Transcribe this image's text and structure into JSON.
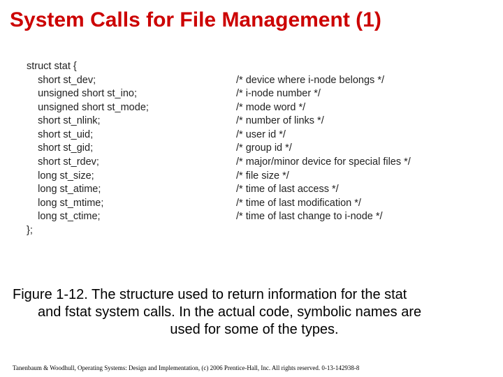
{
  "title": "System Calls for File Management (1)",
  "struct_open": "struct stat {",
  "fields": [
    {
      "decl": "    short st_dev;",
      "cmt": "/* device where i-node belongs */"
    },
    {
      "decl": "    unsigned short st_ino;",
      "cmt": "/* i-node number */"
    },
    {
      "decl": "    unsigned short st_mode;",
      "cmt": "/* mode word */"
    },
    {
      "decl": "    short st_nlink;",
      "cmt": "/* number of links */"
    },
    {
      "decl": "    short st_uid;",
      "cmt": "/* user id */"
    },
    {
      "decl": "    short st_gid;",
      "cmt": "/* group id */"
    },
    {
      "decl": "    short st_rdev;",
      "cmt": "/* major/minor device for special files */"
    },
    {
      "decl": "    long st_size;",
      "cmt": "/* file size */"
    },
    {
      "decl": "    long st_atime;",
      "cmt": "/* time of last access */"
    },
    {
      "decl": "    long st_mtime;",
      "cmt": "/* time of last modification */"
    },
    {
      "decl": "    long st_ctime;",
      "cmt": "/* time of last change to i-node */"
    }
  ],
  "struct_close": "};",
  "caption_l1": "Figure 1-12. The structure used to return information for the stat",
  "caption_l2": "and fstat system calls. In the actual code, symbolic names are",
  "caption_l3": "used for some of the types.",
  "footer": "Tanenbaum & Woodhull, Operating Systems: Design and Implementation, (c) 2006 Prentice-Hall, Inc. All rights reserved. 0-13-142938-8"
}
